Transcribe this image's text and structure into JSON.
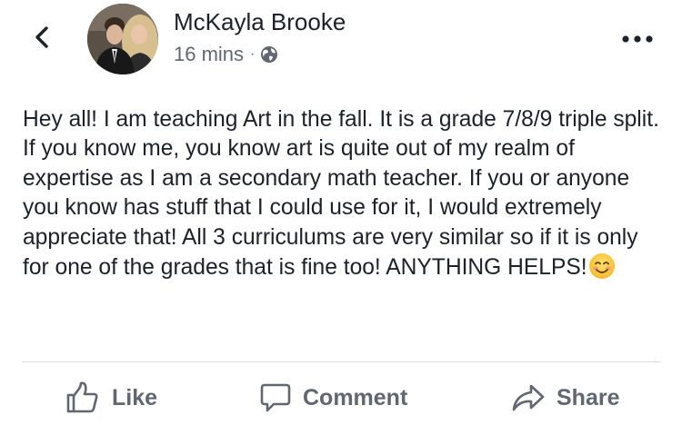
{
  "header": {
    "author_name": "McKayla Brooke",
    "timestamp": "16 mins",
    "separator": "·",
    "privacy_icon": "globe-icon",
    "back_icon": "chevron-left-icon",
    "more_icon": "more-horizontal-icon"
  },
  "post": {
    "text": "Hey all! I am teaching Art in the fall. It is a grade 7/8/9 triple split. If you know me, you know art is quite out of my realm of expertise as I am a secondary math teacher. If you or anyone you know has stuff that I could use for it, I would extremely appreciate that! All 3 curriculums are very similar so if it is only for one of the grades that is fine too! ANYTHING HELPS!",
    "emoji": "smiling-face-emoji"
  },
  "actions": {
    "like_label": "Like",
    "comment_label": "Comment",
    "share_label": "Share"
  },
  "colors": {
    "text_primary": "#1d2129",
    "text_secondary": "#606770",
    "divider": "#dadde1",
    "background": "#ffffff"
  }
}
